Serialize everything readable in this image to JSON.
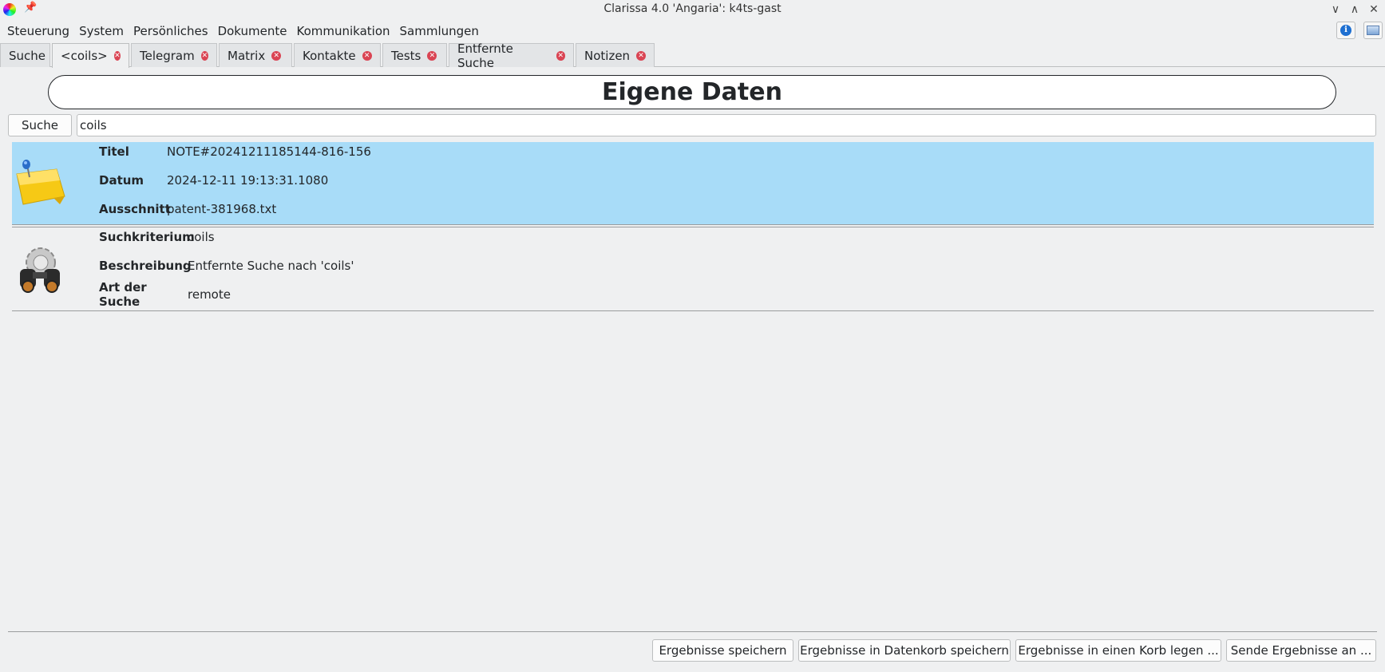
{
  "window": {
    "title": "Clarissa 4.0 'Angaria': k4ts-gast"
  },
  "menu": [
    "Steuerung",
    "System",
    "Persönliches",
    "Dokumente",
    "Kommunikation",
    "Sammlungen"
  ],
  "tabs": [
    {
      "label": "Suche",
      "closable": false
    },
    {
      "label": "<coils>",
      "closable": true,
      "active": true
    },
    {
      "label": "Telegram",
      "closable": true
    },
    {
      "label": "Matrix",
      "closable": true
    },
    {
      "label": "Kontakte",
      "closable": true
    },
    {
      "label": "Tests",
      "closable": true
    },
    {
      "label": "Entfernte Suche",
      "closable": true
    },
    {
      "label": "Notizen",
      "closable": true
    }
  ],
  "header": {
    "title": "Eigene Daten"
  },
  "search": {
    "button_label": "Suche",
    "value": "coils"
  },
  "results": [
    {
      "icon": "sticky-note-icon",
      "selected": true,
      "fields": [
        {
          "label": "Titel",
          "value": "NOTE#20241211185144-816-156"
        },
        {
          "label": "Datum",
          "value": "2024-12-11 19:13:31.1080"
        },
        {
          "label": "Ausschnitt",
          "value": "patent-381968.txt"
        }
      ]
    },
    {
      "icon": "gear-binoculars-icon",
      "selected": false,
      "fields": [
        {
          "label": "Suchkriterium",
          "value": "coils"
        },
        {
          "label": "Beschreibung",
          "value": "Entfernte Suche nach 'coils'"
        },
        {
          "label": "Art der Suche",
          "value": "remote"
        }
      ]
    }
  ],
  "bottom_buttons": [
    "Ergebnisse speichern",
    "Ergebnisse in Datenkorb speichern",
    "Ergebnisse in einen Korb legen ...",
    "Sende Ergebnisse an ..."
  ],
  "colors": {
    "selection": "#a8dcf8",
    "tab_close": "#da4453",
    "background": "#eff0f1"
  }
}
